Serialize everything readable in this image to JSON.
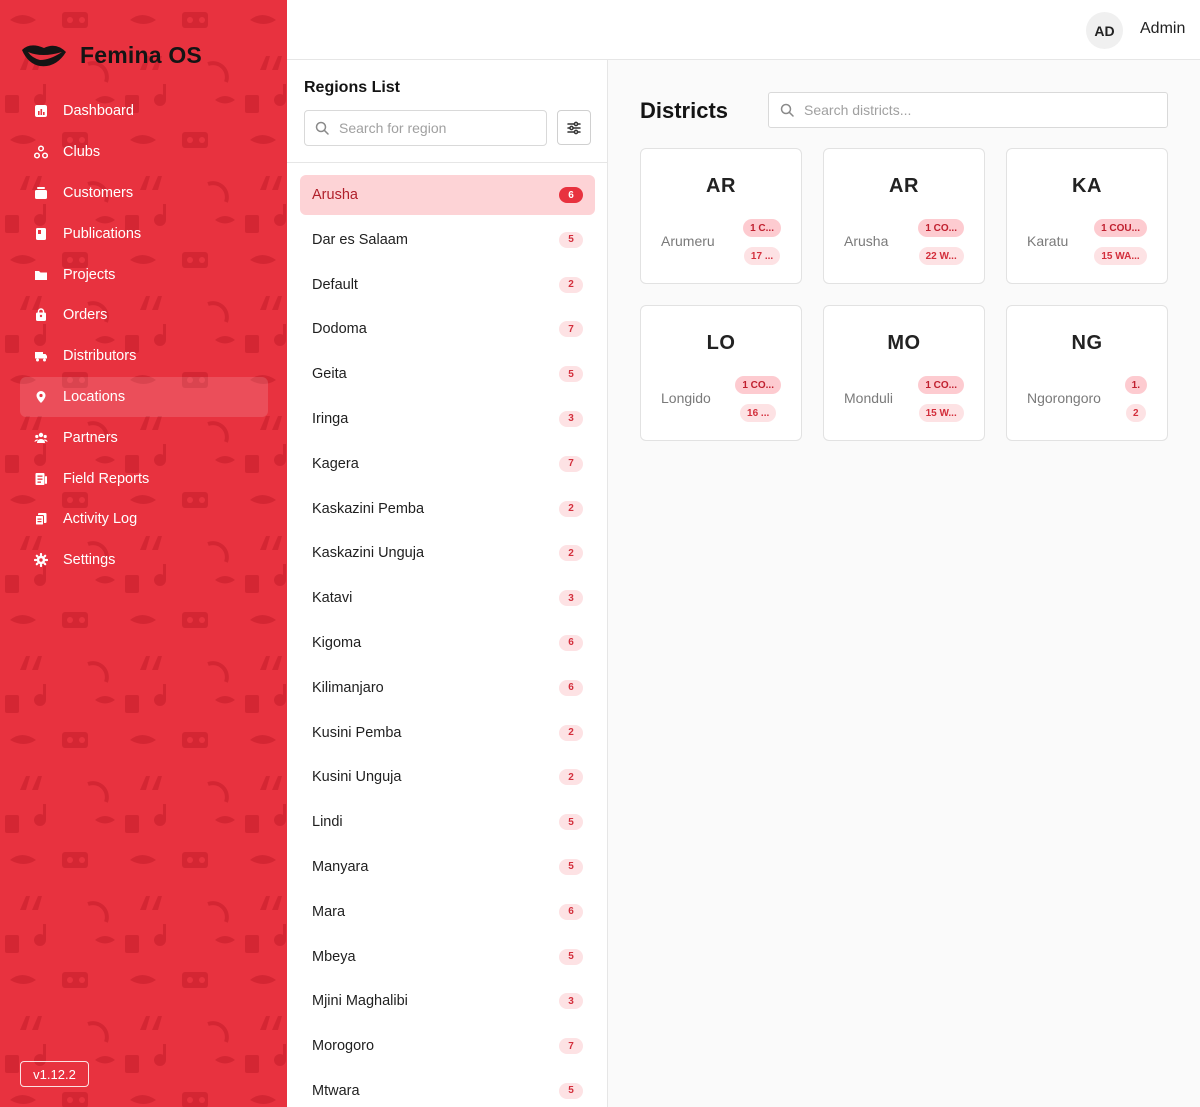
{
  "app": {
    "name": "Femina OS",
    "version": "v1.12.2"
  },
  "sidebar": {
    "items": [
      {
        "label": "Dashboard",
        "icon": "chart-icon"
      },
      {
        "label": "Clubs",
        "icon": "clubs-icon"
      },
      {
        "label": "Customers",
        "icon": "customers-icon"
      },
      {
        "label": "Publications",
        "icon": "book-icon"
      },
      {
        "label": "Projects",
        "icon": "folder-icon"
      },
      {
        "label": "Orders",
        "icon": "bag-icon"
      },
      {
        "label": "Distributors",
        "icon": "truck-icon"
      },
      {
        "label": "Locations",
        "icon": "location-pin-icon",
        "active": true
      },
      {
        "label": "Partners",
        "icon": "people-icon"
      },
      {
        "label": "Field Reports",
        "icon": "report-icon"
      },
      {
        "label": "Activity Log",
        "icon": "log-icon"
      },
      {
        "label": "Settings",
        "icon": "gear-icon"
      }
    ]
  },
  "header": {
    "avatar_initials": "AD",
    "username": "Admin"
  },
  "regions": {
    "title": "Regions List",
    "search_placeholder": "Search for region",
    "items": [
      {
        "name": "Arusha",
        "count": "6",
        "active": true
      },
      {
        "name": "Dar es Salaam",
        "count": "5"
      },
      {
        "name": "Default",
        "count": "2"
      },
      {
        "name": "Dodoma",
        "count": "7"
      },
      {
        "name": "Geita",
        "count": "5"
      },
      {
        "name": "Iringa",
        "count": "3"
      },
      {
        "name": "Kagera",
        "count": "7"
      },
      {
        "name": "Kaskazini Pemba",
        "count": "2"
      },
      {
        "name": "Kaskazini Unguja",
        "count": "2"
      },
      {
        "name": "Katavi",
        "count": "3"
      },
      {
        "name": "Kigoma",
        "count": "6"
      },
      {
        "name": "Kilimanjaro",
        "count": "6"
      },
      {
        "name": "Kusini Pemba",
        "count": "2"
      },
      {
        "name": "Kusini Unguja",
        "count": "2"
      },
      {
        "name": "Lindi",
        "count": "5"
      },
      {
        "name": "Manyara",
        "count": "5"
      },
      {
        "name": "Mara",
        "count": "6"
      },
      {
        "name": "Mbeya",
        "count": "5"
      },
      {
        "name": "Mjini Maghalibi",
        "count": "3"
      },
      {
        "name": "Morogoro",
        "count": "7"
      },
      {
        "name": "Mtwara",
        "count": "5"
      }
    ]
  },
  "districts": {
    "title": "Districts",
    "search_placeholder": "Search districts...",
    "cards": [
      {
        "abbr": "AR",
        "name": "Arumeru",
        "tag1": "1 C...",
        "tag2": "17 ..."
      },
      {
        "abbr": "AR",
        "name": "Arusha",
        "tag1": "1 CO...",
        "tag2": "22 W..."
      },
      {
        "abbr": "KA",
        "name": "Karatu",
        "tag1": "1 COU...",
        "tag2": "15 WA..."
      },
      {
        "abbr": "LO",
        "name": "Longido",
        "tag1": "1 CO...",
        "tag2": "16 ..."
      },
      {
        "abbr": "MO",
        "name": "Monduli",
        "tag1": "1 CO...",
        "tag2": "15 W..."
      },
      {
        "abbr": "NG",
        "name": "Ngorongoro",
        "tag1": "1.",
        "tag2": "2"
      }
    ]
  },
  "colors": {
    "brand": "#e8323f",
    "active_row": "#fdd3d6",
    "badge_bg": "#fde2e4",
    "badge_text": "#d32f3c"
  }
}
